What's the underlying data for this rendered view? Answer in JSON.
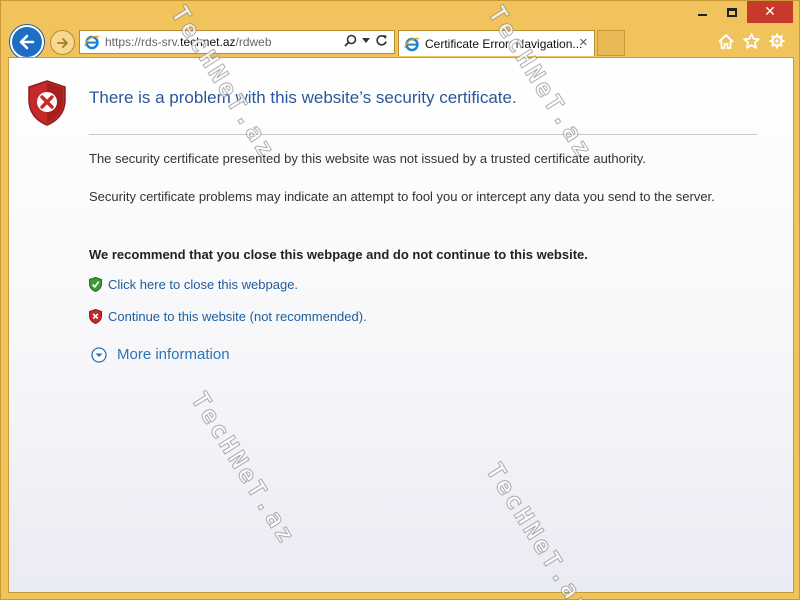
{
  "window": {
    "minimize_label": "Minimize",
    "maximize_label": "Maximize",
    "close_label": "Close"
  },
  "nav": {
    "back_label": "Back",
    "forward_label": "Forward"
  },
  "address": {
    "url_prefix": "https://rds-srv.",
    "url_host": "technet.az",
    "url_suffix": "/rdweb"
  },
  "tab": {
    "title": "Certificate Error: Navigation...",
    "close_glyph": "✕"
  },
  "page": {
    "title": "There is a problem with this website’s security certificate.",
    "paragraph_1": "The security certificate presented by this website was not issued by a trusted certificate authority.",
    "paragraph_2": "Security certificate problems may indicate an attempt to fool you or intercept any data you send to the server.",
    "recommendation": "We recommend that you close this webpage and do not continue to this website.",
    "close_link": "Click here to close this webpage.",
    "continue_link": "Continue to this website (not recommended).",
    "more_info": "More information"
  },
  "watermark": "TecHNeT.az",
  "icons": {
    "back": "back-arrow-icon",
    "forward": "forward-arrow-icon",
    "ie": "internet-explorer-icon",
    "search": "search-icon",
    "dropdown": "chevron-down-icon",
    "refresh": "refresh-icon",
    "home": "home-icon",
    "favorites": "star-icon",
    "settings": "gear-icon",
    "shield_error": "shield-error-icon",
    "shield_ok": "shield-check-icon",
    "expand": "expand-circle-icon"
  },
  "colors": {
    "frame": "#f0c35c",
    "accent_blue": "#2a579a",
    "link_blue": "#1c5d9e",
    "error_red": "#c7392b",
    "ok_green": "#3c9a32"
  }
}
